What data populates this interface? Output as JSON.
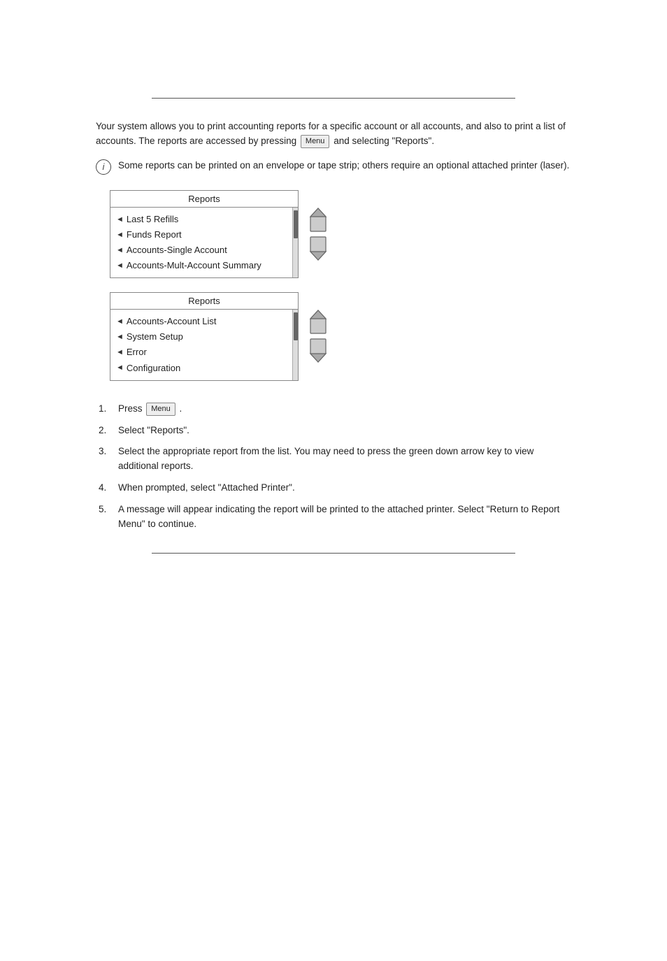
{
  "page": {
    "top_rule": true,
    "bottom_rule": true
  },
  "intro": {
    "paragraph": "Your system allows you to print accounting reports for a specific account or all accounts, and also to print a list of accounts. The reports are accessed by pressing      and selecting \"Reports\".",
    "info_note": "Some reports can be printed on an envelope or tape strip; others require an optional attached printer (laser)."
  },
  "menu1": {
    "title": "Reports",
    "items": [
      "Last 5 Refills",
      "Funds Report",
      "Accounts-Single Account",
      "Accounts-Mult-Account Summary"
    ]
  },
  "menu2": {
    "title": "Reports",
    "items": [
      "Accounts-Account List",
      "System Setup",
      "Error",
      "Configuration"
    ]
  },
  "steps": [
    {
      "num": "1.",
      "text": "Press      ."
    },
    {
      "num": "2.",
      "text": "Select \"Reports\"."
    },
    {
      "num": "3.",
      "text": "Select the appropriate report from the list. You may need to press the green down arrow key to view additional reports."
    },
    {
      "num": "4.",
      "text": "When prompted, select \"Attached Printer\"."
    },
    {
      "num": "5.",
      "text": "A message will appear indicating the report will be printed to the attached printer. Select \"Return to Report Menu\" to continue."
    }
  ]
}
